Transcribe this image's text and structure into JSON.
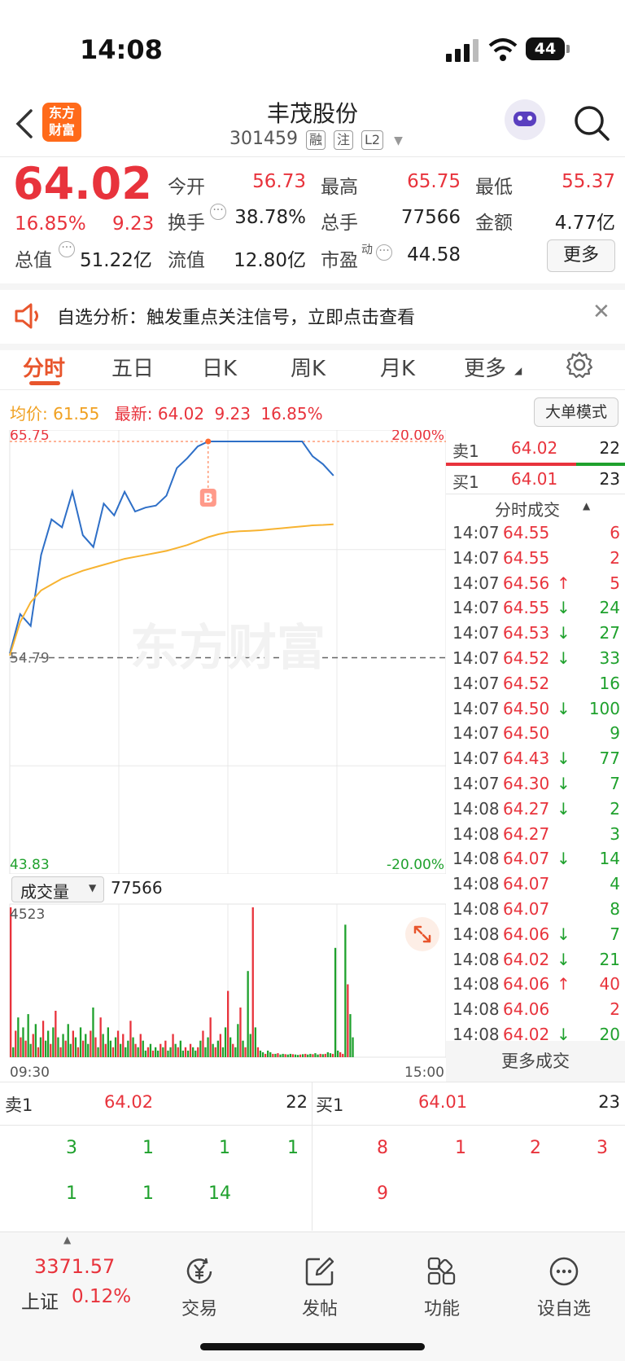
{
  "status_bar": {
    "time": "14:08",
    "battery": "44"
  },
  "header": {
    "title": "丰茂股份",
    "code": "301459",
    "tags": [
      "融",
      "注",
      "L2"
    ],
    "logo_text_1": "东方",
    "logo_text_2": "财富"
  },
  "quote": {
    "price": "64.02",
    "pct": "16.85%",
    "chg": "9.23",
    "rows": [
      [
        {
          "label": "今开",
          "value": "56.73",
          "color": "red"
        },
        {
          "label": "最高",
          "value": "65.75",
          "color": "red"
        },
        {
          "label": "最低",
          "value": "55.37",
          "color": "red"
        }
      ],
      [
        {
          "label": "换手",
          "value": "38.78%",
          "color": "dark"
        },
        {
          "label": "总手",
          "value": "77566",
          "color": "dark"
        },
        {
          "label": "金额",
          "value": "4.77亿",
          "color": "dark"
        }
      ]
    ],
    "total_cap_label": "总值",
    "total_cap": "51.22亿",
    "float_cap_label": "流值",
    "float_cap": "12.80亿",
    "pe_label": "市盈",
    "pe_sup": "动",
    "pe": "44.58",
    "more_label": "更多"
  },
  "banner": {
    "text": "自选分析：触发重点关注信号，立即点击查看"
  },
  "tabs": [
    "分时",
    "五日",
    "日K",
    "周K",
    "月K",
    "更多"
  ],
  "chart_info": {
    "avg_label": "均价:",
    "avg_value": "61.55",
    "latest_label": "最新:",
    "latest_value": "64.02",
    "latest_chg": "9.23",
    "latest_pct": "16.85%",
    "mode_button": "大单模式"
  },
  "chart_data": [
    {
      "type": "line",
      "title": "",
      "series": [
        {
          "values": [
            55.0,
            57.0,
            56.4,
            60.0,
            61.8,
            61.4,
            63.2,
            61.0,
            60.4,
            62.6,
            62.0,
            63.2,
            62.2,
            62.4,
            62.5,
            63.0,
            64.4,
            64.9,
            65.5,
            65.75,
            65.75,
            65.75,
            65.75,
            65.75,
            65.75,
            65.75,
            65.75,
            65.75,
            65.75,
            65.0,
            64.6,
            64.02
          ]
        },
        {
          "values": [
            54.9,
            56.6,
            57.6,
            58.2,
            58.5,
            58.8,
            59.0,
            59.2,
            59.35,
            59.5,
            59.65,
            59.8,
            59.9,
            60.0,
            60.1,
            60.2,
            60.35,
            60.5,
            60.7,
            60.9,
            61.05,
            61.15,
            61.2,
            61.22,
            61.25,
            61.3,
            61.35,
            61.4,
            61.45,
            61.5,
            61.52,
            61.55
          ]
        }
      ],
      "y_labels": {
        "top": "65.75",
        "mid": "54.79",
        "bottom": "43.83",
        "top_pct": "20.00%",
        "bottom_pct": "-20.00%"
      },
      "ylim": [
        43.83,
        65.75
      ],
      "marker": "B",
      "watermark": "东方财富"
    },
    {
      "type": "bar",
      "title": "",
      "ylabel_value": "4523",
      "ylim": [
        0,
        4523
      ],
      "x_start": "09:30",
      "x_end": "15:00",
      "values": [
        4523,
        300,
        800,
        1200,
        600,
        900,
        500,
        1300,
        400,
        700,
        1000,
        300,
        600,
        1100,
        500,
        800,
        400,
        900,
        1400,
        600,
        300,
        700,
        500,
        1000,
        400,
        800,
        600,
        300,
        900,
        500,
        700,
        400,
        800,
        1500,
        600,
        300,
        1200,
        700,
        400,
        900,
        500,
        300,
        600,
        800,
        400,
        700,
        300,
        500,
        1100,
        600,
        400,
        300,
        700,
        500,
        200,
        300,
        400,
        200,
        300,
        200,
        400,
        300,
        500,
        200,
        300,
        700,
        400,
        300,
        500,
        200,
        300,
        200,
        400,
        300,
        200,
        300,
        500,
        800,
        300,
        600,
        1200,
        400,
        300,
        500,
        700,
        300,
        900,
        2000,
        600,
        400,
        300,
        1000,
        1500,
        500,
        300,
        2600,
        700,
        4523,
        900,
        300,
        200,
        150,
        100,
        200,
        150,
        100,
        100,
        120,
        80,
        100,
        90,
        80,
        100,
        90,
        80,
        70,
        80,
        90,
        100,
        80,
        100,
        90,
        120,
        80,
        100,
        90,
        100,
        150,
        120,
        100,
        3300,
        200,
        150,
        100,
        4000,
        2200,
        1300,
        600
      ],
      "up": [
        1,
        0,
        1,
        0,
        1,
        0,
        1,
        0,
        0,
        1,
        0,
        1,
        0,
        1,
        0,
        0,
        1,
        0,
        1,
        0,
        1,
        0,
        1,
        0,
        0,
        1,
        0,
        1,
        0,
        1,
        0,
        0,
        1,
        0,
        1,
        0,
        1,
        0,
        1,
        0,
        0,
        1,
        0,
        1,
        0,
        1,
        0,
        0,
        1,
        0,
        1,
        0,
        1,
        0,
        0,
        1,
        0,
        1,
        0,
        0,
        1,
        0,
        1,
        0,
        0,
        1,
        0,
        1,
        0,
        0,
        1,
        0,
        1,
        0,
        0,
        1,
        0,
        1,
        0,
        0,
        1,
        0,
        1,
        0,
        1,
        0,
        0,
        1,
        0,
        1,
        0,
        0,
        1,
        0,
        1,
        0,
        0,
        1,
        0,
        1,
        0,
        0,
        1,
        0,
        0,
        1,
        0,
        1,
        0,
        0,
        1,
        0,
        0,
        1,
        0,
        0,
        1,
        0,
        1,
        0,
        0,
        1,
        0,
        0,
        1,
        0,
        1,
        0,
        0,
        1,
        0,
        0,
        1,
        1,
        0,
        1,
        0
      ]
    }
  ],
  "volume_label": "成交量",
  "volume_total": "77566",
  "trade_panel": {
    "sell_label": "卖1",
    "sell_price": "64.02",
    "sell_qty": "22",
    "buy_label": "买1",
    "buy_price": "64.01",
    "buy_qty": "23",
    "list_title": "分时成交",
    "trades": [
      {
        "time": "14:07",
        "price": "64.55",
        "arrow": "",
        "qty": "6",
        "qcolor": "red"
      },
      {
        "time": "14:07",
        "price": "64.55",
        "arrow": "",
        "qty": "2",
        "qcolor": "red"
      },
      {
        "time": "14:07",
        "price": "64.56",
        "arrow": "↑",
        "qty": "5",
        "qcolor": "red"
      },
      {
        "time": "14:07",
        "price": "64.55",
        "arrow": "↓",
        "qty": "24",
        "qcolor": "green"
      },
      {
        "time": "14:07",
        "price": "64.53",
        "arrow": "↓",
        "qty": "27",
        "qcolor": "green"
      },
      {
        "time": "14:07",
        "price": "64.52",
        "arrow": "↓",
        "qty": "33",
        "qcolor": "green"
      },
      {
        "time": "14:07",
        "price": "64.52",
        "arrow": "",
        "qty": "16",
        "qcolor": "green"
      },
      {
        "time": "14:07",
        "price": "64.50",
        "arrow": "↓",
        "qty": "100",
        "qcolor": "green"
      },
      {
        "time": "14:07",
        "price": "64.50",
        "arrow": "",
        "qty": "9",
        "qcolor": "green"
      },
      {
        "time": "14:07",
        "price": "64.43",
        "arrow": "↓",
        "qty": "77",
        "qcolor": "green"
      },
      {
        "time": "14:07",
        "price": "64.30",
        "arrow": "↓",
        "qty": "7",
        "qcolor": "green"
      },
      {
        "time": "14:08",
        "price": "64.27",
        "arrow": "↓",
        "qty": "2",
        "qcolor": "green"
      },
      {
        "time": "14:08",
        "price": "64.27",
        "arrow": "",
        "qty": "3",
        "qcolor": "green"
      },
      {
        "time": "14:08",
        "price": "64.07",
        "arrow": "↓",
        "qty": "14",
        "qcolor": "green"
      },
      {
        "time": "14:08",
        "price": "64.07",
        "arrow": "",
        "qty": "4",
        "qcolor": "green"
      },
      {
        "time": "14:08",
        "price": "64.07",
        "arrow": "",
        "qty": "8",
        "qcolor": "green"
      },
      {
        "time": "14:08",
        "price": "64.06",
        "arrow": "↓",
        "qty": "7",
        "qcolor": "green"
      },
      {
        "time": "14:08",
        "price": "64.02",
        "arrow": "↓",
        "qty": "21",
        "qcolor": "green"
      },
      {
        "time": "14:08",
        "price": "64.06",
        "arrow": "↑",
        "qty": "40",
        "qcolor": "red"
      },
      {
        "time": "14:08",
        "price": "64.06",
        "arrow": "",
        "qty": "2",
        "qcolor": "red"
      },
      {
        "time": "14:08",
        "price": "64.02",
        "arrow": "↓",
        "qty": "20",
        "qcolor": "green"
      }
    ],
    "more_trades": "更多成交"
  },
  "order_book": {
    "sell_label": "卖1",
    "sell_price": "64.02",
    "sell_qty": "22",
    "buy_label": "买1",
    "buy_price": "64.01",
    "buy_qty": "23",
    "sell_orders_row1": [
      "3",
      "1",
      "1",
      "1"
    ],
    "sell_orders_row2": [
      "1",
      "1",
      "14"
    ],
    "buy_orders_row1": [
      "8",
      "1",
      "2",
      "3"
    ],
    "buy_orders_row2": [
      "9"
    ]
  },
  "bottom_bar": {
    "index_value": "3371.57",
    "index_name": "上证",
    "index_pct": "0.12%",
    "items": [
      {
        "label": "交易",
        "icon": "yen-trade-icon"
      },
      {
        "label": "发帖",
        "icon": "edit-post-icon"
      },
      {
        "label": "功能",
        "icon": "apps-grid-icon"
      },
      {
        "label": "设自选",
        "icon": "more-dots-icon"
      }
    ]
  }
}
